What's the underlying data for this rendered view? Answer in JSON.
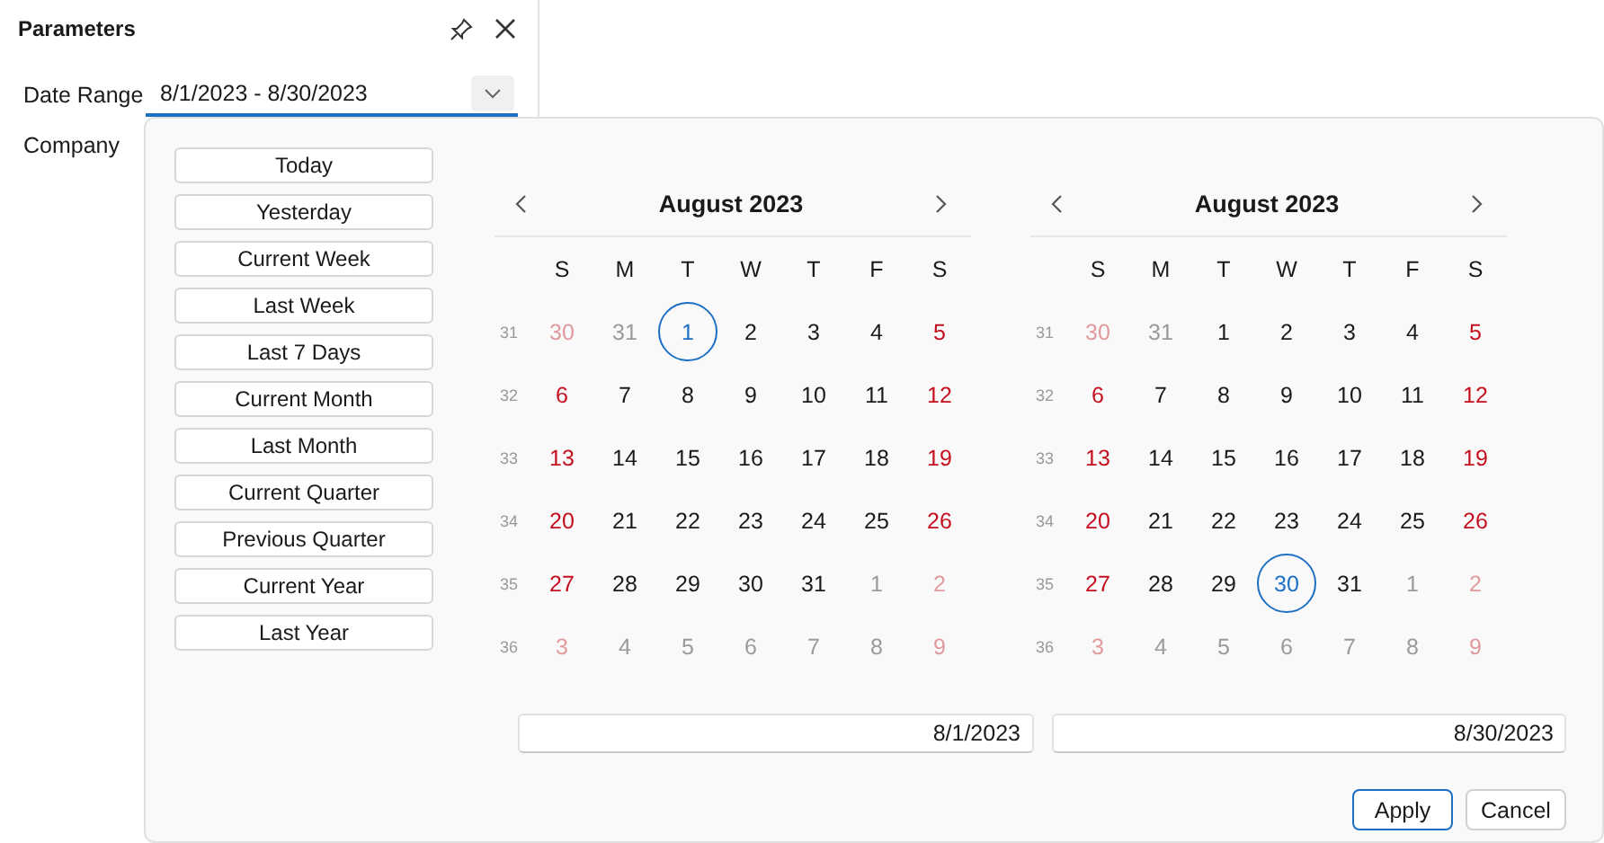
{
  "panel": {
    "title": "Parameters",
    "fields": [
      {
        "label": "Date Range",
        "value": "8/1/2023 - 8/30/2023"
      },
      {
        "label": "Company"
      }
    ]
  },
  "presets": [
    "Today",
    "Yesterday",
    "Current Week",
    "Last Week",
    "Last 7 Days",
    "Current Month",
    "Last Month",
    "Current Quarter",
    "Previous Quarter",
    "Current Year",
    "Last Year"
  ],
  "calendars": [
    {
      "title": "August 2023",
      "weekdays": [
        "S",
        "M",
        "T",
        "W",
        "T",
        "F",
        "S"
      ],
      "weeks": [
        {
          "number": "31",
          "days": [
            {
              "day": "30",
              "outside": true,
              "selected": false
            },
            {
              "day": "31",
              "outside": true,
              "selected": false
            },
            {
              "day": "1",
              "outside": false,
              "selected": true
            },
            {
              "day": "2",
              "outside": false,
              "selected": false
            },
            {
              "day": "3",
              "outside": false,
              "selected": false
            },
            {
              "day": "4",
              "outside": false,
              "selected": false
            },
            {
              "day": "5",
              "outside": false,
              "selected": false
            }
          ]
        },
        {
          "number": "32",
          "days": [
            {
              "day": "6",
              "outside": false,
              "selected": false
            },
            {
              "day": "7",
              "outside": false,
              "selected": false
            },
            {
              "day": "8",
              "outside": false,
              "selected": false
            },
            {
              "day": "9",
              "outside": false,
              "selected": false
            },
            {
              "day": "10",
              "outside": false,
              "selected": false
            },
            {
              "day": "11",
              "outside": false,
              "selected": false
            },
            {
              "day": "12",
              "outside": false,
              "selected": false
            }
          ]
        },
        {
          "number": "33",
          "days": [
            {
              "day": "13",
              "outside": false,
              "selected": false
            },
            {
              "day": "14",
              "outside": false,
              "selected": false
            },
            {
              "day": "15",
              "outside": false,
              "selected": false
            },
            {
              "day": "16",
              "outside": false,
              "selected": false
            },
            {
              "day": "17",
              "outside": false,
              "selected": false
            },
            {
              "day": "18",
              "outside": false,
              "selected": false
            },
            {
              "day": "19",
              "outside": false,
              "selected": false
            }
          ]
        },
        {
          "number": "34",
          "days": [
            {
              "day": "20",
              "outside": false,
              "selected": false
            },
            {
              "day": "21",
              "outside": false,
              "selected": false
            },
            {
              "day": "22",
              "outside": false,
              "selected": false
            },
            {
              "day": "23",
              "outside": false,
              "selected": false
            },
            {
              "day": "24",
              "outside": false,
              "selected": false
            },
            {
              "day": "25",
              "outside": false,
              "selected": false
            },
            {
              "day": "26",
              "outside": false,
              "selected": false
            }
          ]
        },
        {
          "number": "35",
          "days": [
            {
              "day": "27",
              "outside": false,
              "selected": false
            },
            {
              "day": "28",
              "outside": false,
              "selected": false
            },
            {
              "day": "29",
              "outside": false,
              "selected": false
            },
            {
              "day": "30",
              "outside": false,
              "selected": false
            },
            {
              "day": "31",
              "outside": false,
              "selected": false
            },
            {
              "day": "1",
              "outside": true,
              "selected": false
            },
            {
              "day": "2",
              "outside": true,
              "selected": false
            }
          ]
        },
        {
          "number": "36",
          "days": [
            {
              "day": "3",
              "outside": true,
              "selected": false
            },
            {
              "day": "4",
              "outside": true,
              "selected": false
            },
            {
              "day": "5",
              "outside": true,
              "selected": false
            },
            {
              "day": "6",
              "outside": true,
              "selected": false
            },
            {
              "day": "7",
              "outside": true,
              "selected": false
            },
            {
              "day": "8",
              "outside": true,
              "selected": false
            },
            {
              "day": "9",
              "outside": true,
              "selected": false
            }
          ]
        }
      ],
      "date_value": "8/1/2023"
    },
    {
      "title": "August 2023",
      "weekdays": [
        "S",
        "M",
        "T",
        "W",
        "T",
        "F",
        "S"
      ],
      "weeks": [
        {
          "number": "31",
          "days": [
            {
              "day": "30",
              "outside": true,
              "selected": false
            },
            {
              "day": "31",
              "outside": true,
              "selected": false
            },
            {
              "day": "1",
              "outside": false,
              "selected": false
            },
            {
              "day": "2",
              "outside": false,
              "selected": false
            },
            {
              "day": "3",
              "outside": false,
              "selected": false
            },
            {
              "day": "4",
              "outside": false,
              "selected": false
            },
            {
              "day": "5",
              "outside": false,
              "selected": false
            }
          ]
        },
        {
          "number": "32",
          "days": [
            {
              "day": "6",
              "outside": false,
              "selected": false
            },
            {
              "day": "7",
              "outside": false,
              "selected": false
            },
            {
              "day": "8",
              "outside": false,
              "selected": false
            },
            {
              "day": "9",
              "outside": false,
              "selected": false
            },
            {
              "day": "10",
              "outside": false,
              "selected": false
            },
            {
              "day": "11",
              "outside": false,
              "selected": false
            },
            {
              "day": "12",
              "outside": false,
              "selected": false
            }
          ]
        },
        {
          "number": "33",
          "days": [
            {
              "day": "13",
              "outside": false,
              "selected": false
            },
            {
              "day": "14",
              "outside": false,
              "selected": false
            },
            {
              "day": "15",
              "outside": false,
              "selected": false
            },
            {
              "day": "16",
              "outside": false,
              "selected": false
            },
            {
              "day": "17",
              "outside": false,
              "selected": false
            },
            {
              "day": "18",
              "outside": false,
              "selected": false
            },
            {
              "day": "19",
              "outside": false,
              "selected": false
            }
          ]
        },
        {
          "number": "34",
          "days": [
            {
              "day": "20",
              "outside": false,
              "selected": false
            },
            {
              "day": "21",
              "outside": false,
              "selected": false
            },
            {
              "day": "22",
              "outside": false,
              "selected": false
            },
            {
              "day": "23",
              "outside": false,
              "selected": false
            },
            {
              "day": "24",
              "outside": false,
              "selected": false
            },
            {
              "day": "25",
              "outside": false,
              "selected": false
            },
            {
              "day": "26",
              "outside": false,
              "selected": false
            }
          ]
        },
        {
          "number": "35",
          "days": [
            {
              "day": "27",
              "outside": false,
              "selected": false
            },
            {
              "day": "28",
              "outside": false,
              "selected": false
            },
            {
              "day": "29",
              "outside": false,
              "selected": false
            },
            {
              "day": "30",
              "outside": false,
              "selected": true
            },
            {
              "day": "31",
              "outside": false,
              "selected": false
            },
            {
              "day": "1",
              "outside": true,
              "selected": false
            },
            {
              "day": "2",
              "outside": true,
              "selected": false
            }
          ]
        },
        {
          "number": "36",
          "days": [
            {
              "day": "3",
              "outside": true,
              "selected": false
            },
            {
              "day": "4",
              "outside": true,
              "selected": false
            },
            {
              "day": "5",
              "outside": true,
              "selected": false
            },
            {
              "day": "6",
              "outside": true,
              "selected": false
            },
            {
              "day": "7",
              "outside": true,
              "selected": false
            },
            {
              "day": "8",
              "outside": true,
              "selected": false
            },
            {
              "day": "9",
              "outside": true,
              "selected": false
            }
          ]
        }
      ],
      "date_value": "8/30/2023"
    }
  ],
  "buttons": [
    {
      "label": "Apply",
      "kind": "primary"
    },
    {
      "label": "Cancel",
      "kind": "secondary"
    }
  ]
}
